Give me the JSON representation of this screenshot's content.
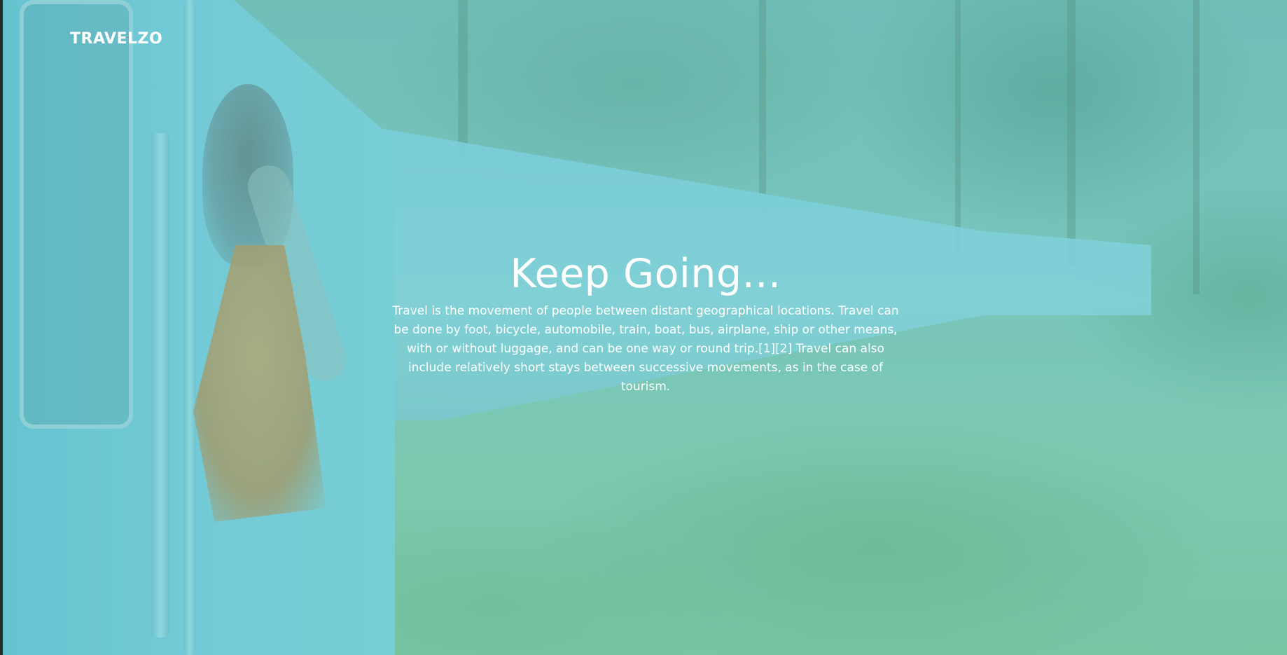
{
  "brand": {
    "logo_text": "TRAVELZO"
  },
  "hero": {
    "title": "Keep Going...",
    "description": "Travel is the movement of people between distant geographical locations. Travel can be done by foot, bicycle, automobile, train, boat, bus, airplane, ship or other means, with or without luggage, and can be one way or round trip.[1][2] Travel can also include relatively short stays between successive movements, as in the case of tourism."
  },
  "colors": {
    "overlay_tint": "#78cdc8",
    "text": "#ffffff",
    "left_edge": "#2b2b2b"
  }
}
